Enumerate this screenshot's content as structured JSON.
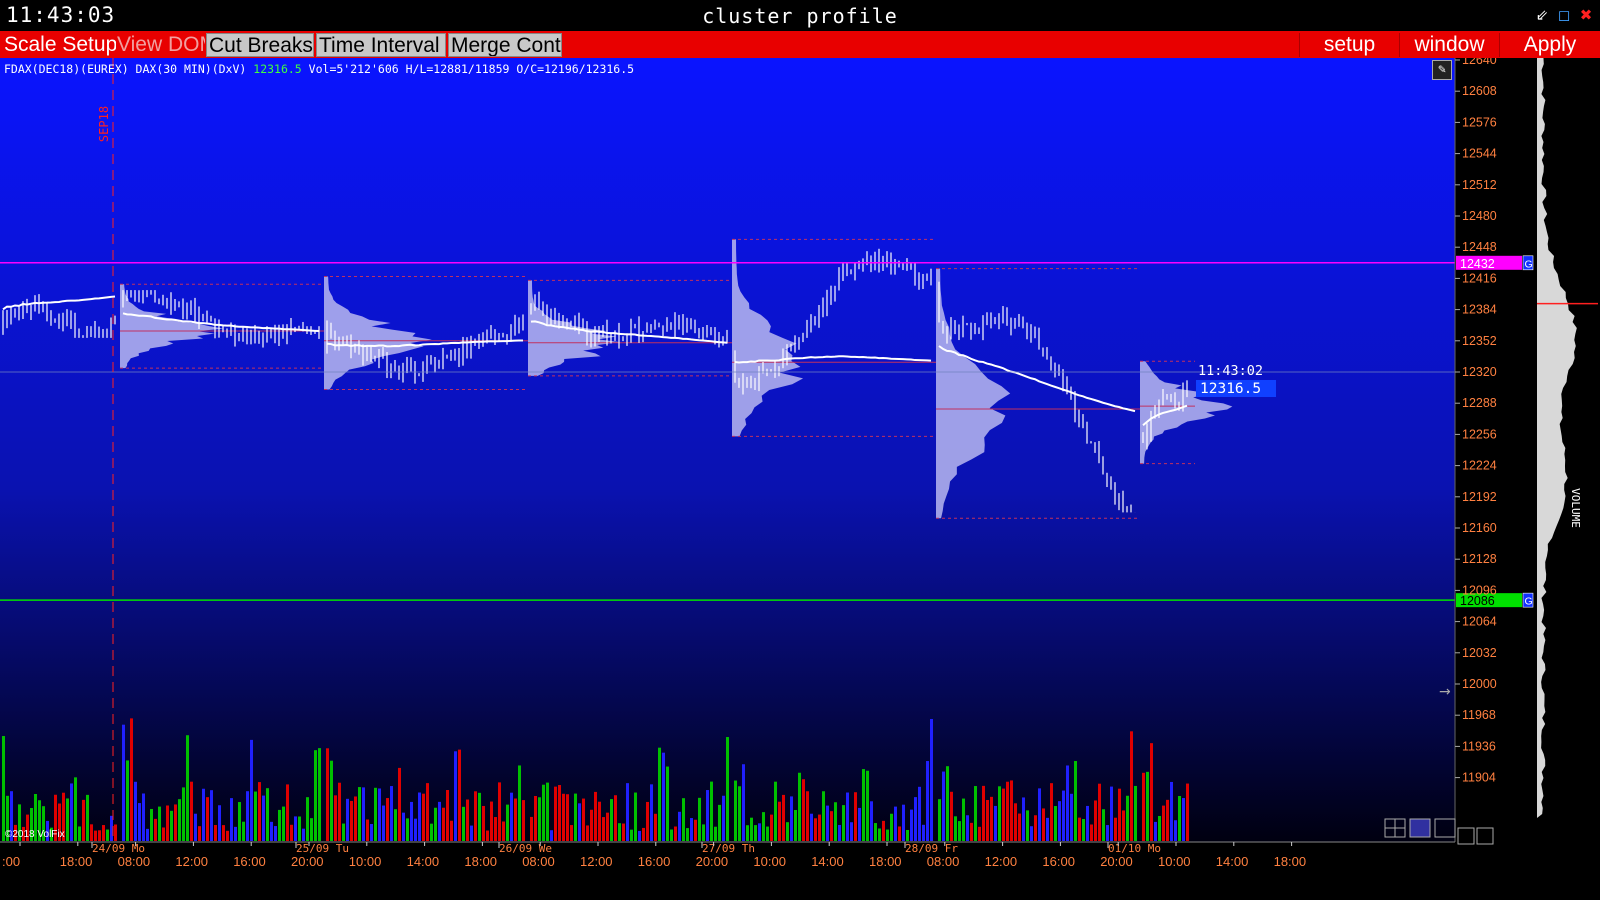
{
  "window": {
    "clock": "11:43:03",
    "title": "cluster profile",
    "controls": [
      {
        "name": "minimize-icon",
        "glyph": "⇙",
        "color": "#ffffff"
      },
      {
        "name": "restore-icon",
        "glyph": "◻",
        "color": "#40a0ff"
      },
      {
        "name": "close-icon",
        "glyph": "✖",
        "color": "#ff2020"
      }
    ]
  },
  "toolbar": {
    "scale_setup": "Scale Setup",
    "view_dom": "View DOM",
    "cut_breaks": "Cut Breaks",
    "time_interval": "Time Interval",
    "merge_contr": "Merge Contr",
    "setup": "setup",
    "window": "window",
    "apply": "Apply"
  },
  "info": {
    "symbol": "FDAX(DEC18)(EUREX) DAX(30 MIN)(DxV)",
    "last": "12316.5",
    "stats": "Vol=5'212'606  H/L=12881/11859  O/C=12196/12316.5"
  },
  "chart_data": {
    "type": "candlestick",
    "price_axis": {
      "ticks": [
        12640,
        12608,
        12576,
        12544,
        12512,
        12480,
        12448,
        12416,
        12384,
        12352,
        12320,
        12288,
        12256,
        12224,
        12192,
        12160,
        12128,
        12096,
        12064,
        12032,
        12000,
        11968,
        11936,
        11904
      ],
      "ylim": [
        11880,
        12640
      ]
    },
    "levels": [
      {
        "price": 12432,
        "label": "12432",
        "tag": "G",
        "color": "#ff00ff"
      },
      {
        "price": 12086,
        "label": "12086",
        "tag": "G",
        "color": "#00e000"
      }
    ],
    "contract_marker": "SEP18",
    "last_time": "11:43:02",
    "last_price": "12316.5",
    "date_labels": [
      "24/09 Mo",
      "25/09 Tu",
      "26/09 We",
      "27/09 Th",
      "28/09 Fr",
      "01/10 Mo"
    ],
    "time_labels": [
      ":00",
      "18:00",
      "08:00",
      "12:00",
      "16:00",
      "20:00",
      "10:00",
      "14:00",
      "18:00",
      "08:00",
      "12:00",
      "16:00",
      "20:00",
      "10:00",
      "14:00",
      "18:00",
      "08:00",
      "12:00",
      "16:00",
      "20:00",
      "10:00",
      "14:00",
      "18:00"
    ],
    "copyright": "©2018 VolFix",
    "side_label": "VOLUME",
    "sessions": [
      {
        "open": 12375,
        "close": 12372,
        "high": 12425,
        "low": 12355,
        "vwap": 12398
      },
      {
        "open": 12392,
        "close": 12358,
        "high": 12404,
        "low": 12330,
        "vwap": 12362
      },
      {
        "open": 12340,
        "close": 12346,
        "high": 12412,
        "low": 12308,
        "vwap": 12352
      },
      {
        "open": 12390,
        "close": 12342,
        "high": 12408,
        "low": 12322,
        "vwap": 12350
      },
      {
        "open": 12338,
        "close": 12430,
        "high": 12450,
        "low": 12260,
        "vwap": 12330
      },
      {
        "open": 12410,
        "close": 12210,
        "high": 12420,
        "low": 12176,
        "vwap": 12282
      },
      {
        "open": 12250,
        "close": 12316.5,
        "high": 12325,
        "low": 12232,
        "vwap": 12285
      }
    ],
    "colors": {
      "up": "#ffffff",
      "down": "#ffffff",
      "vwap": "#ffffff",
      "profile": "#b8b8f0",
      "vol_red": "#e00000",
      "vol_green": "#00c000",
      "vol_blue": "#2020ff"
    }
  }
}
